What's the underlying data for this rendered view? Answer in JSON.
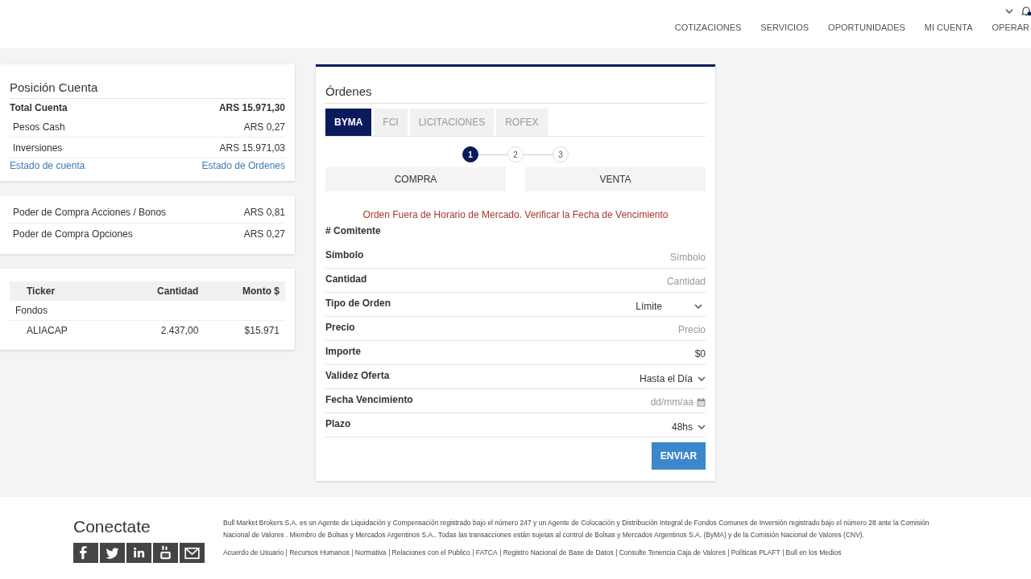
{
  "nav": {
    "items": [
      "COTIZACIONES",
      "SERVICIOS",
      "OPORTUNIDADES",
      "MI CUENTA",
      "OPERAR"
    ]
  },
  "account": {
    "title": "Posición Cuenta",
    "rows": [
      {
        "label": "Total Cuenta",
        "value": "ARS 15.971,30",
        "kind": "total"
      },
      {
        "label": "Pesos Cash",
        "value": "ARS 0,27",
        "kind": "sub"
      },
      {
        "label": "Inversiones",
        "value": "ARS 15.971,03",
        "kind": "sub"
      }
    ],
    "links": [
      "Estado de cuenta",
      "Estado de Ordenes"
    ]
  },
  "buying_power": [
    {
      "label": "Poder de Compra Acciones / Bonos",
      "value": "ARS 0,81"
    },
    {
      "label": "Poder de Compra Opciones",
      "value": "ARS 0,27"
    }
  ],
  "holdings": {
    "columns": [
      "Ticker",
      "Cantidad",
      "Monto $"
    ],
    "group": "Fondos",
    "rows": [
      [
        "ALIACAP",
        "2.437,00",
        "$15.971"
      ]
    ]
  },
  "orders": {
    "title": "Órdenes",
    "tabs": [
      {
        "label": "BYMA",
        "selected": true
      },
      {
        "label": "FCI",
        "selected": false
      },
      {
        "label": "LICITACIONES",
        "selected": false
      },
      {
        "label": "ROFEX",
        "selected": false
      }
    ],
    "steps": [
      {
        "label": "1",
        "selected": true
      },
      {
        "label": "2",
        "selected": false
      },
      {
        "label": "3",
        "selected": false
      }
    ],
    "sides": [
      {
        "label": "COMPRA",
        "selected": false
      },
      {
        "label": "VENTA",
        "selected": false
      }
    ],
    "warning": "Orden Fuera de Horario de Mercado. Verificar la Fecha de Vencimiento",
    "fields": [
      {
        "label": "# Comitente",
        "kind": "label"
      },
      {
        "label": "Símbolo",
        "kind": "input",
        "placeholder": "Símbolo"
      },
      {
        "label": "Cantidad",
        "kind": "input",
        "placeholder": "Cantidad"
      },
      {
        "label": "Tipo de Orden",
        "kind": "dropdown",
        "value": "Límite"
      },
      {
        "label": "Precio",
        "kind": "input",
        "placeholder": "Precio"
      },
      {
        "label": "Importe",
        "kind": "amount",
        "value": "$0"
      },
      {
        "label": "Validez Oferta",
        "kind": "select",
        "value": "Hasta el Día"
      },
      {
        "label": "Fecha Vencimiento",
        "kind": "date",
        "placeholder": "dd/mm/aa"
      },
      {
        "label": "Plazo",
        "kind": "select",
        "value": "48hs"
      }
    ],
    "submit": "ENVIAR"
  },
  "footer": {
    "title": "Conectate",
    "legal": "Bull Market Brokers S.A. es un Agente de Liquidación y Compensación registrado bajo el número 247 y un Agente de Colocación y Distribución Integral de Fondos Comunes de Inversión registrado bajo el número 28 ante la Comisión Nacional de Valores . Miembro de Bolsas y Mercados Argentinos S.A.. Todas las transacciones están sujetas al control de Bolsas y Mercados Argentinos S.A. (ByMA) y de la Comisión Nacional de Valores (CNV).",
    "links": [
      "Acuerdo de Usuario",
      "Recursos Humanos",
      "Normativa",
      "Relaciones con el Publico",
      "FATCA",
      "Registro Nacional de Base de Datos",
      "Consulte Tenencia Caja de Valores",
      "Políticas PLAFT",
      "Bull en los Medios"
    ]
  }
}
